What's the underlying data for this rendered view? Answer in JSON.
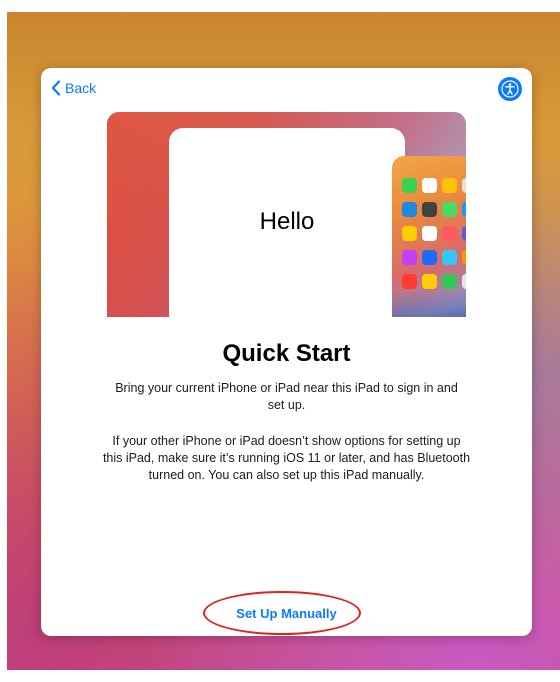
{
  "nav": {
    "back_label": "Back",
    "accessibility_icon": "accessibility-icon"
  },
  "hero": {
    "hello_text": "Hello",
    "app_icon_colors": [
      "#39d353",
      "#ffffff",
      "#ffc107",
      "#e0e0e0",
      "#1e88e5",
      "#424242",
      "#4cd964",
      "#2196f3",
      "#ffcc00",
      "#ffffff",
      "#ff5a5f",
      "#5e5ce6",
      "#bf40ff",
      "#1e6bff",
      "#34c6ff",
      "#ff9500",
      "#ff3b30",
      "#ffcc00",
      "#34c759",
      "#e5e5ea"
    ]
  },
  "content": {
    "title": "Quick Start",
    "paragraph1": "Bring your current iPhone or iPad near this iPad to sign in and set up.",
    "paragraph2": "If your other iPhone or iPad doesn’t show options for setting up this iPad, make sure it’s running iOS 11 or later, and has Bluetooth turned on. You can also set up this iPad manually.",
    "setup_manually_label": "Set Up Manually"
  },
  "colors": {
    "accent": "#0a7aff",
    "annotation": "#e0231b"
  }
}
